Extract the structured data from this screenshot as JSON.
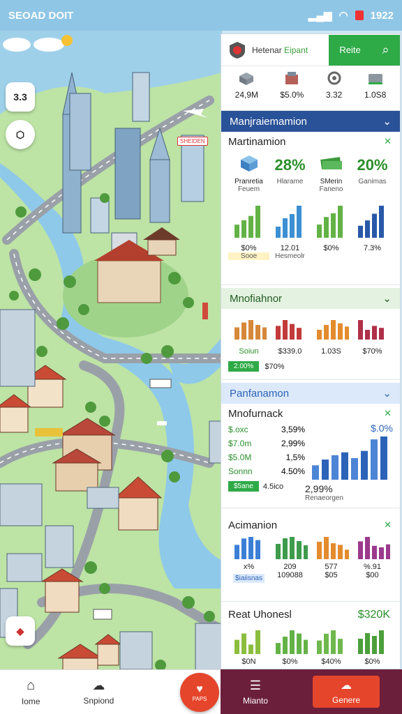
{
  "status": {
    "left_text": "SEOAD DOIT",
    "time": "1922"
  },
  "map": {
    "btn_top": "3.3",
    "label_tag": "SHEIDEN",
    "colors": {
      "water": "#9fd0ea",
      "grass": "#bde3a5",
      "road": "#9aa0a8"
    }
  },
  "panel": {
    "header": {
      "title_a": "Hetenar",
      "title_b": "Eipant",
      "button": "Reite"
    },
    "stats": [
      {
        "icon": "box-icon",
        "value": "24,9M"
      },
      {
        "icon": "building-icon",
        "value": "$5.0%"
      },
      {
        "icon": "gear-icon",
        "value": "3.32"
      },
      {
        "icon": "bus-icon",
        "value": "1.0S8"
      }
    ],
    "section1": {
      "bar": "Manjraiemamion",
      "card_title": "Martinamion",
      "items": [
        {
          "label_a": "Pranretia",
          "label_b": "Feuem",
          "value": ""
        },
        {
          "label_a": "Hlarame",
          "label_b": "",
          "value": "28%"
        },
        {
          "label_a": "SMerin",
          "label_b": "Faneno",
          "value": ""
        },
        {
          "label_a": "Ganimas",
          "label_b": "",
          "value": "20%"
        }
      ],
      "foot": [
        {
          "value": "$0%",
          "label": "Sooe"
        },
        {
          "value": "12.01",
          "label": "Hesmeolr"
        },
        {
          "value": "$0%",
          "label": ""
        },
        {
          "value": "7.3%",
          "label": ""
        }
      ],
      "bars": [
        [
          18,
          24,
          30,
          44
        ],
        [
          16,
          28,
          34,
          46
        ],
        [
          14,
          22,
          26,
          34
        ],
        [
          18,
          26,
          36,
          48
        ]
      ]
    },
    "section2": {
      "bar": "Mnofiahnor",
      "values": [
        "Soiun",
        "$339.0",
        "1.03S",
        "$70%"
      ],
      "badge": "2.00%",
      "sub": "$70%",
      "bars": [
        [
          10,
          14,
          16,
          12,
          10
        ],
        [
          14,
          20,
          16,
          12
        ],
        [
          12,
          18,
          24,
          20,
          16
        ],
        [
          20,
          10,
          14,
          12
        ]
      ]
    },
    "section3": {
      "bar": "Panfanamon",
      "card_title": "Mnofurnack",
      "rows": [
        [
          "$.oxc",
          "3,59%"
        ],
        [
          "$7.0m",
          "2,99%"
        ],
        [
          "$5.0M",
          "1,5%"
        ],
        [
          "Sonnn",
          "4.50%"
        ]
      ],
      "badge_a": "$5ane",
      "badge_b": "4.5ico",
      "big_top": "$.0%",
      "big_value": "2,99%",
      "big_label": "Renaeorgen",
      "bars": [
        20,
        28,
        34,
        38,
        30,
        40,
        56,
        60
      ]
    },
    "section4": {
      "card_title": "Acimanion",
      "labels": [
        "x%",
        "209",
        "577",
        "%.91"
      ],
      "badge": "$iaiisnas",
      "vals": [
        "109088",
        "$05",
        "$00"
      ],
      "bars": [
        [
          18,
          26,
          28,
          24
        ],
        [
          22,
          30,
          32,
          26,
          20
        ],
        [
          22,
          28,
          20,
          18,
          12
        ],
        [
          24,
          30,
          18,
          16,
          20
        ]
      ]
    },
    "section5": {
      "card_title": "Reat Uhonesl",
      "value": "$320K",
      "vals": [
        "$0N",
        "$0%",
        "$40%",
        "$0%"
      ],
      "bars": [
        [
          18,
          26,
          12,
          30
        ],
        [
          14,
          22,
          30,
          26,
          18
        ],
        [
          16,
          24,
          28,
          18
        ],
        [
          22,
          30,
          26,
          34
        ]
      ]
    }
  },
  "nav": {
    "home": "Iome",
    "spend": "Snpiond",
    "fab": "PAPS",
    "menu": "Mianto",
    "gen": "Genere"
  }
}
